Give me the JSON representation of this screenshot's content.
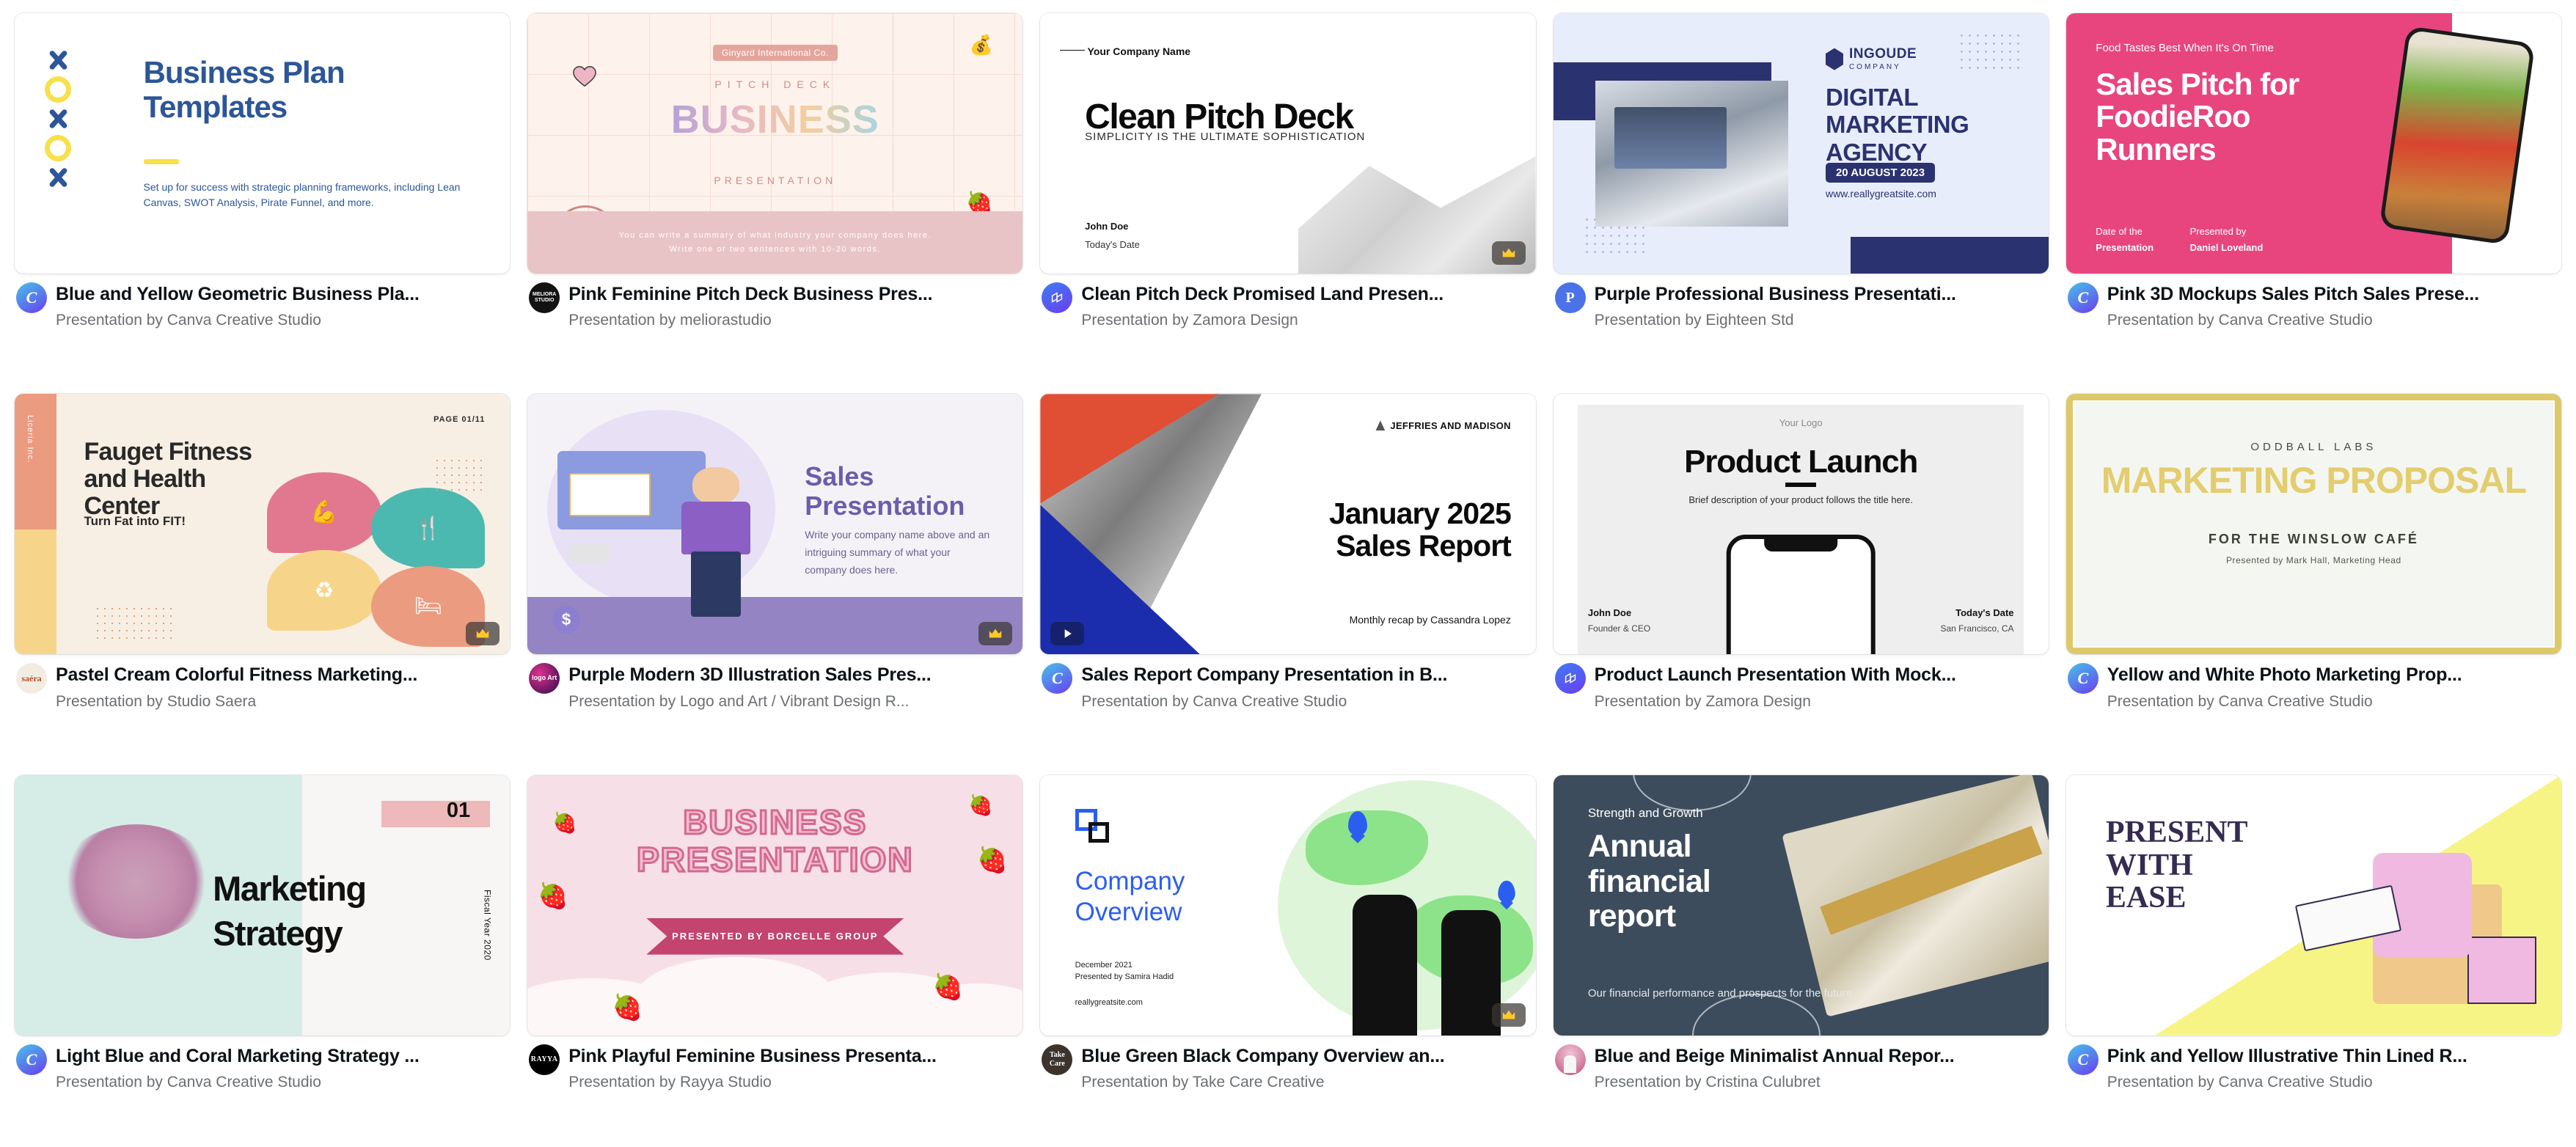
{
  "gallery": {
    "label": "presentation-template-gallery",
    "byline_prefix": "Presentation by",
    "cards": [
      {
        "title": "Blue and Yellow Geometric Business Pla...",
        "author": "Presentation by Canva Creative Studio",
        "avatar_kind": "canva-logo",
        "avatar_text": "C",
        "badge": "none",
        "slide": {
          "heading": "Business Plan\nTemplates",
          "body": "Set up for success with strategic planning frameworks, including Lean Canvas, SWOT Analysis, Pirate Funnel, and more.",
          "accent": "#2c5697",
          "accent2": "#f7e04a"
        }
      },
      {
        "title": "Pink Feminine Pitch Deck Business Pres...",
        "author": "Presentation by meliorastudio",
        "avatar_kind": "meliora-studio",
        "avatar_text": "MELIORA STUDIO",
        "badge": "none",
        "slide": {
          "tag": "Ginyard International Co.",
          "kicker": "PITCH DECK",
          "wordmark": "BUSINESS",
          "sub": "PRESENTATION",
          "band_line1": "You can write a summary of what industry your company does here.",
          "band_line2": "Write one or two sentences with 10-20 words.",
          "accent": "#e9c4c6"
        }
      },
      {
        "title": "Clean Pitch Deck Promised Land Presen...",
        "author": "Presentation by Zamora Design",
        "avatar_kind": "zamora-design",
        "avatar_text": "Z",
        "badge": "crown",
        "slide": {
          "company": "Your Company Name",
          "heading": "Clean Pitch Deck",
          "sub": "SIMPLICITY IS THE ULTIMATE SOPHISTICATION",
          "name": "John Doe",
          "date": "Today's Date",
          "accent": "#0a0a0a"
        }
      },
      {
        "title": "Purple Professional Business Presentati...",
        "author": "Presentation by Eighteen Std",
        "avatar_kind": "eighteen-std",
        "avatar_text": "P",
        "badge": "none",
        "slide": {
          "logo_name": "INGOUDE",
          "logo_sub": "COMPANY",
          "heading": "DIGITAL\nMARKETING\nAGENCY",
          "date_pill": "20 AUGUST 2023",
          "url": "www.reallygreatsite.com",
          "accent": "#2b3270"
        }
      },
      {
        "title": "Pink 3D Mockups Sales Pitch Sales Prese...",
        "author": "Presentation by Canva Creative Studio",
        "avatar_kind": "canva-logo",
        "avatar_text": "C",
        "badge": "none",
        "slide": {
          "kicker": "Food Tastes Best When It's On Time",
          "heading": "Sales Pitch for\nFoodieRoo\nRunners",
          "label1": "Date of the",
          "value1": "Presentation",
          "label2": "Presented by",
          "value2": "Daniel Loveland",
          "accent": "#e8457f"
        }
      },
      {
        "title": "Pastel Cream Colorful Fitness Marketing...",
        "author": "Presentation by Studio Saera",
        "avatar_kind": "studio-saera",
        "avatar_text": "saéra",
        "badge": "crown",
        "slide": {
          "side_label": "Liceria Inc.",
          "page": "PAGE 01/11",
          "heading": "Fauget Fitness\nand Health\nCenter",
          "sub": "Turn Fat into FIT!",
          "accent": "#eb9b80"
        }
      },
      {
        "title": "Purple Modern 3D Illustration Sales Pres...",
        "author": "Presentation by Logo and Art / Vibrant Design R...",
        "avatar_kind": "logo-and-art",
        "avatar_text": "logo Art",
        "badge": "crown",
        "slide": {
          "heading": "Sales\nPresentation",
          "body": "Write your company name above and an intriguing summary of what your company does here.",
          "accent": "#9584c4"
        }
      },
      {
        "title": "Sales Report Company Presentation in B...",
        "author": "Presentation by Canva Creative Studio",
        "avatar_kind": "canva-logo",
        "avatar_text": "C",
        "badge": "play",
        "slide": {
          "logo": "JEFFRIES AND MADISON",
          "heading": "January 2025\nSales Report",
          "sub": "Monthly recap by Cassandra Lopez",
          "accent": "#1b2dad",
          "accent2": "#e04f34"
        }
      },
      {
        "title": "Product Launch Presentation With Mock...",
        "author": "Presentation by Zamora Design",
        "avatar_kind": "zamora-design",
        "avatar_text": "Z",
        "badge": "none",
        "slide": {
          "logo": "Your Logo",
          "heading": "Product Launch",
          "body": "Brief description of your product follows the title here.",
          "name": "John Doe",
          "role": "Founder & CEO",
          "date": "Today's Date",
          "location": "San Francisco, CA",
          "accent": "#0c0c0c"
        }
      },
      {
        "title": "Yellow and White Photo Marketing Prop...",
        "author": "Presentation by Canva Creative Studio",
        "avatar_kind": "canva-logo",
        "avatar_text": "C",
        "badge": "none",
        "slide": {
          "kicker": "ODDBALL LABS",
          "heading": "MARKETING PROPOSAL",
          "sub": "FOR THE WINSLOW CAFÉ",
          "byline": "Presented by Mark Hall, Marketing Head",
          "accent": "#ddc96a"
        }
      },
      {
        "title": "Light Blue and Coral Marketing Strategy ...",
        "author": "Presentation by Canva Creative Studio",
        "avatar_kind": "canva-logo",
        "avatar_text": "C",
        "badge": "none",
        "slide": {
          "heading": "Marketing\nStrategy",
          "number": "01",
          "fiscal": "Fiscal Year 2020",
          "accent": "#d6ece7",
          "accent2": "#edb9ba"
        }
      },
      {
        "title": "Pink Playful Feminine Business Presenta...",
        "author": "Presentation by Rayya Studio",
        "avatar_kind": "rayya-studio",
        "avatar_text": "RAYYA",
        "badge": "none",
        "slide": {
          "heading": "BUSINESS PRESENTATION",
          "ribbon": "PRESENTED BY BORCELLE GROUP",
          "accent": "#c2446f"
        }
      },
      {
        "title": "Blue Green Black Company Overview an...",
        "author": "Presentation by Take Care Creative",
        "avatar_kind": "take-care-creative",
        "avatar_text": "Take Care",
        "badge": "crown",
        "slide": {
          "heading": "Company\nOverview",
          "date": "December 2021",
          "byline": "Presented by Samira Hadid",
          "url": "reallygreatsite.com",
          "accent": "#2b5ef0"
        }
      },
      {
        "title": "Blue and Beige Minimalist Annual Repor...",
        "author": "Presentation by Cristina Culubret",
        "avatar_kind": "photo-avatar",
        "avatar_text": "",
        "badge": "none",
        "slide": {
          "kicker": "Strength and Growth",
          "heading": "Annual\nfinancial\nreport",
          "body": "Our financial performance and prospects for the future",
          "accent": "#3d4c5c"
        }
      },
      {
        "title": "Pink and Yellow Illustrative Thin Lined R...",
        "author": "Presentation by Canva Creative Studio",
        "avatar_kind": "canva-logo",
        "avatar_text": "C",
        "badge": "none",
        "slide": {
          "heading": "PRESENT\nWITH\nEASE",
          "accent": "#f7f486",
          "accent2": "#352b52"
        }
      }
    ]
  }
}
